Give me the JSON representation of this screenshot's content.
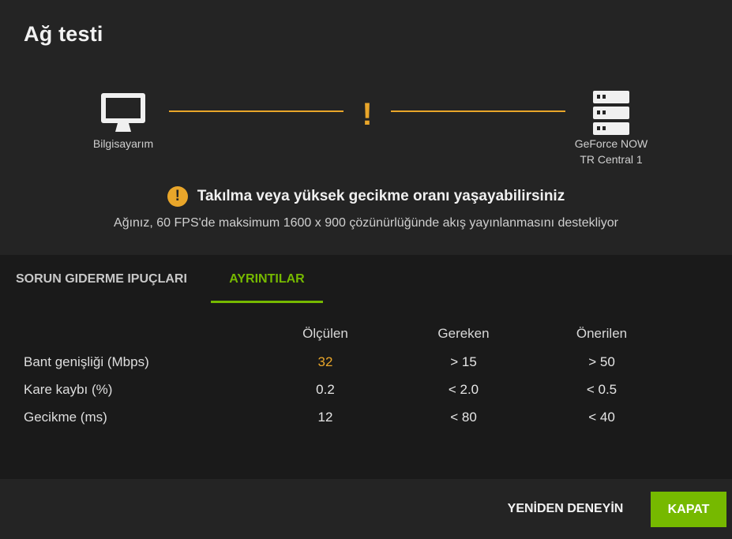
{
  "dialog": {
    "title": "Ağ testi"
  },
  "connection": {
    "local_label": "Bilgisayarım",
    "local_icon": "monitor-icon",
    "server_label_line1": "GeForce NOW",
    "server_label_line2": "TR Central 1",
    "server_icon": "server-icon",
    "link_mark": "!",
    "warning_color": "#e9a62a"
  },
  "status": {
    "icon": "!",
    "title": "Takılma veya yüksek gecikme oranı yaşayabilirsiniz",
    "subtitle": "Ağınız, 60 FPS'de maksimum 1600 x 900 çözünürlüğünde akış yayınlanmasını destekliyor"
  },
  "tabs": [
    {
      "label": "SORUN GIDERME IPUÇLARI",
      "active": false
    },
    {
      "label": "AYRINTILAR",
      "active": true
    }
  ],
  "details": {
    "columns": [
      "Ölçülen",
      "Gereken",
      "Önerilen"
    ],
    "rows": [
      {
        "label": "Bant genişliği (Mbps)",
        "measured": "32",
        "required": "> 15",
        "recommended": "> 50"
      },
      {
        "label": "Kare kaybı (%)",
        "measured": "0.2",
        "required": "< 2.0",
        "recommended": "< 0.5"
      },
      {
        "label": "Gecikme (ms)",
        "measured": "12",
        "required": "< 80",
        "recommended": "< 40"
      }
    ]
  },
  "buttons": {
    "retry": "YENİDEN DENEYİN",
    "close": "KAPAT"
  },
  "colors": {
    "accent": "#76b900",
    "warning": "#e9a62a"
  }
}
